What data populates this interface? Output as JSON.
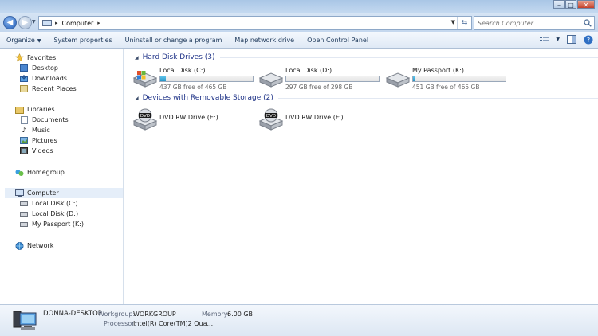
{
  "window": {
    "minimize": "–",
    "maximize": "□",
    "close": "✕"
  },
  "address": {
    "path": "Computer",
    "separator": "▸"
  },
  "search": {
    "placeholder": "Search Computer"
  },
  "toolbar": {
    "items": [
      "Organize",
      "System properties",
      "Uninstall or change a program",
      "Map network drive",
      "Open Control Panel"
    ]
  },
  "nav": {
    "favorites": {
      "label": "Favorites",
      "items": [
        "Desktop",
        "Downloads",
        "Recent Places"
      ]
    },
    "libraries": {
      "label": "Libraries",
      "items": [
        "Documents",
        "Music",
        "Pictures",
        "Videos"
      ]
    },
    "homegroup": "Homegroup",
    "computer": {
      "label": "Computer",
      "items": [
        "Local Disk (C:)",
        "Local Disk (D:)",
        "My Passport (K:)"
      ]
    },
    "network": "Network"
  },
  "groups": {
    "hdd": {
      "label": "Hard Disk Drives (3)"
    },
    "removable": {
      "label": "Devices with Removable Storage (2)"
    }
  },
  "drives": [
    {
      "name": "Local Disk (C:)",
      "free": "437 GB free of 465 GB",
      "used_fraction": 0.06
    },
    {
      "name": "Local Disk (D:)",
      "free": "297 GB free of 298 GB",
      "used_fraction": 0.0
    },
    {
      "name": "My Passport (K:)",
      "free": "451 GB free of 465 GB",
      "used_fraction": 0.03
    }
  ],
  "removable": [
    {
      "name": "DVD RW Drive (E:)",
      "badge": "DVD"
    },
    {
      "name": "DVD RW Drive (F:)",
      "badge": "DVD"
    }
  ],
  "status": {
    "computer_name": "DONNA-DESKTOP",
    "workgroup_label": "Workgroup:",
    "workgroup": "WORKGROUP",
    "memory_label": "Memory:",
    "memory": "6.00 GB",
    "processor_label": "Processor:",
    "processor": "Intel(R) Core(TM)2 Qua..."
  }
}
